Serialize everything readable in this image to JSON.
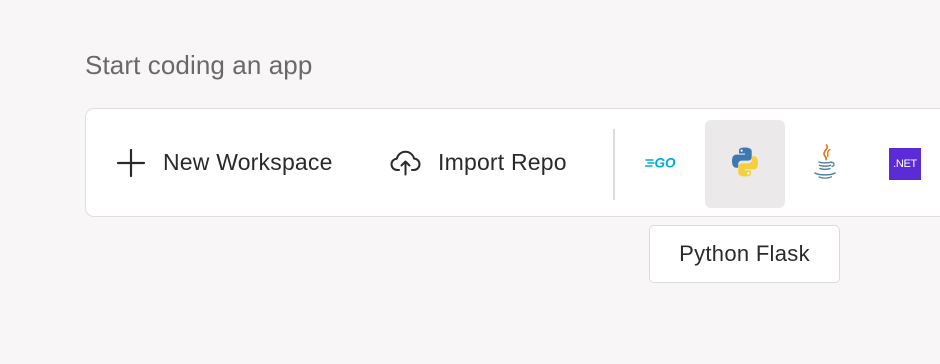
{
  "section": {
    "title": "Start coding an app"
  },
  "actions": {
    "new_workspace_label": "New Workspace",
    "import_repo_label": "Import Repo"
  },
  "languages": [
    {
      "name": "go",
      "icon": "go-logo-icon",
      "badge_text": "GO",
      "color": "#00acd7"
    },
    {
      "name": "python",
      "icon": "python-logo-icon",
      "selected": true
    },
    {
      "name": "java",
      "icon": "java-logo-icon"
    },
    {
      "name": "dotnet",
      "icon": "dotnet-logo-icon",
      "badge_text": ".NET",
      "color": "#5c2bd8"
    }
  ],
  "tooltip": {
    "text": "Python Flask"
  }
}
